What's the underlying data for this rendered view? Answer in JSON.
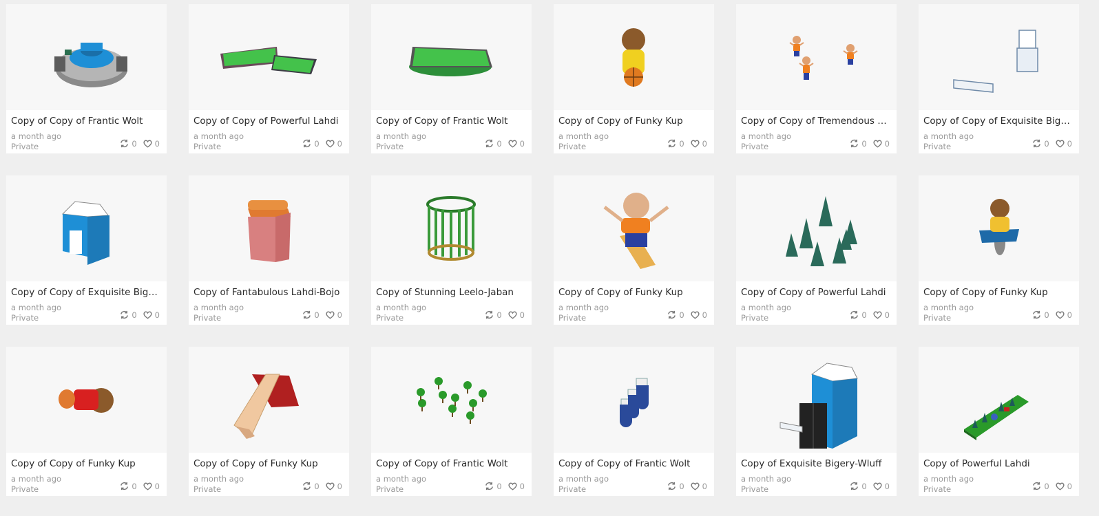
{
  "icons": {
    "remix": "remix-icon",
    "like": "heart-icon"
  },
  "designs": [
    {
      "title": "Copy of Copy of Frantic Wolt",
      "time": "a month ago",
      "privacy": "Private",
      "remixes": "0",
      "likes": "0",
      "thumb": "round-building"
    },
    {
      "title": "Copy of Copy of Powerful Lahdi",
      "time": "a month ago",
      "privacy": "Private",
      "remixes": "0",
      "likes": "0",
      "thumb": "two-fields"
    },
    {
      "title": "Copy of Copy of Frantic Wolt",
      "time": "a month ago",
      "privacy": "Private",
      "remixes": "0",
      "likes": "0",
      "thumb": "one-field"
    },
    {
      "title": "Copy of Copy of Funky Kup",
      "time": "a month ago",
      "privacy": "Private",
      "remixes": "0",
      "likes": "0",
      "thumb": "basketball-kid"
    },
    {
      "title": "Copy of Copy of Tremendous Ro...",
      "time": "a month ago",
      "privacy": "Private",
      "remixes": "0",
      "likes": "0",
      "thumb": "three-kids"
    },
    {
      "title": "Copy of Copy of Exquisite Biger...",
      "time": "a month ago",
      "privacy": "Private",
      "remixes": "0",
      "likes": "0",
      "thumb": "box-and-bar"
    },
    {
      "title": "Copy of Copy of Exquisite Biger...",
      "time": "a month ago",
      "privacy": "Private",
      "remixes": "0",
      "likes": "0",
      "thumb": "blue-house"
    },
    {
      "title": "Copy of Fantabulous Lahdi-Bojo",
      "time": "a month ago",
      "privacy": "Private",
      "remixes": "0",
      "likes": "0",
      "thumb": "pink-block"
    },
    {
      "title": "Copy of Stunning Leelo-Jaban",
      "time": "a month ago",
      "privacy": "Private",
      "remixes": "0",
      "likes": "0",
      "thumb": "green-cage"
    },
    {
      "title": "Copy of Copy of Funky Kup",
      "time": "a month ago",
      "privacy": "Private",
      "remixes": "0",
      "likes": "0",
      "thumb": "skateboard-kid"
    },
    {
      "title": "Copy of Copy of Powerful Lahdi",
      "time": "a month ago",
      "privacy": "Private",
      "remixes": "0",
      "likes": "0",
      "thumb": "pine-trees"
    },
    {
      "title": "Copy of Copy of Funky Kup",
      "time": "a month ago",
      "privacy": "Private",
      "remixes": "0",
      "likes": "0",
      "thumb": "spring-kid"
    },
    {
      "title": "Copy of Copy of Funky Kup",
      "time": "a month ago",
      "privacy": "Private",
      "remixes": "0",
      "likes": "0",
      "thumb": "lying-kid"
    },
    {
      "title": "Copy of Copy of Funky Kup",
      "time": "a month ago",
      "privacy": "Private",
      "remixes": "0",
      "likes": "0",
      "thumb": "slide"
    },
    {
      "title": "Copy of Copy of Frantic Wolt",
      "time": "a month ago",
      "privacy": "Private",
      "remixes": "0",
      "likes": "0",
      "thumb": "round-trees"
    },
    {
      "title": "Copy of Copy of Frantic Wolt",
      "time": "a month ago",
      "privacy": "Private",
      "remixes": "0",
      "likes": "0",
      "thumb": "blue-blocks"
    },
    {
      "title": "Copy of Exquisite Bigery-Wluff",
      "time": "a month ago",
      "privacy": "Private",
      "remixes": "0",
      "likes": "0",
      "thumb": "house-door"
    },
    {
      "title": "Copy of Powerful Lahdi",
      "time": "a month ago",
      "privacy": "Private",
      "remixes": "0",
      "likes": "0",
      "thumb": "forest-plate"
    }
  ]
}
